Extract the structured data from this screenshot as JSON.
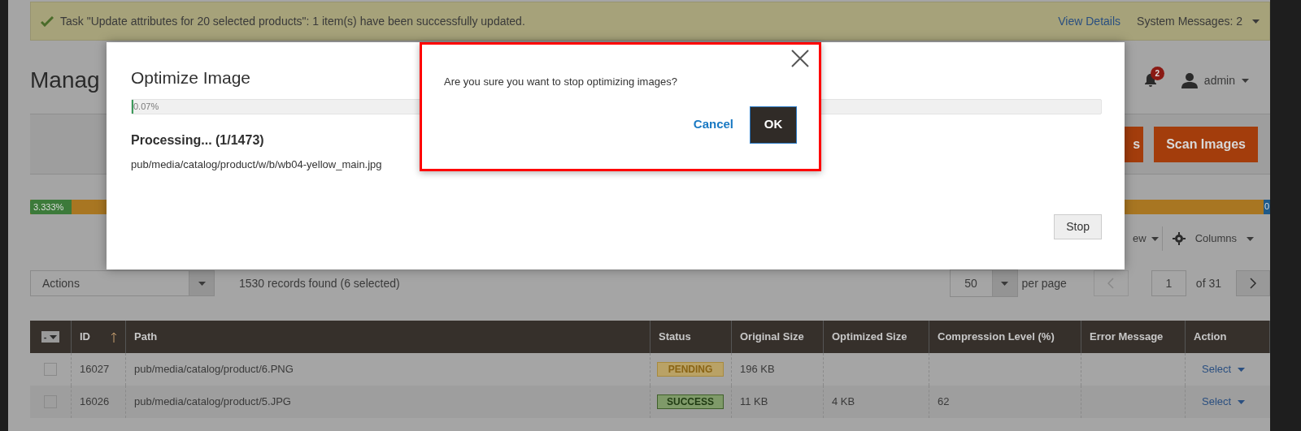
{
  "notification": {
    "message": "Task \"Update attributes for 20 selected products\": 1 item(s) have been successfully updated.",
    "link": "View Details",
    "system_messages": "System Messages: 2"
  },
  "header": {
    "title": "Manag",
    "notification_count": "2",
    "user": "admin"
  },
  "header_buttons": [
    {
      "label": "s"
    },
    {
      "label": "Scan Images"
    }
  ],
  "scan_progress": {
    "label": "3.333%",
    "level": 0.03333,
    "end_label": "0"
  },
  "toolbar": {
    "view": "ew",
    "columns": "Columns"
  },
  "grid": {
    "actions": "Actions",
    "records": "1530 records found (6 selected)",
    "per_page": "50",
    "per_page_label": "per page",
    "page": "1",
    "page_of": "of 31"
  },
  "table": {
    "mass_select": "-",
    "columns": [
      {
        "label": "ID",
        "sorted": true
      },
      {
        "label": "Path",
        "sorted": false
      },
      {
        "label": "Status",
        "sorted": false
      },
      {
        "label": "Original Size",
        "sorted": false
      },
      {
        "label": "Optimized Size",
        "sorted": false
      },
      {
        "label": "Compression Level (%)",
        "sorted": false
      },
      {
        "label": "Error Message",
        "sorted": false
      },
      {
        "label": "Action",
        "sorted": false
      }
    ],
    "rows": [
      {
        "checked": false,
        "id": "16027",
        "path": "pub/media/catalog/product/6.PNG",
        "status": {
          "label": "PENDING",
          "kind": "pending"
        },
        "original": "196 KB",
        "optimized": "",
        "compression": "",
        "error": "",
        "action": "Select"
      },
      {
        "checked": false,
        "id": "16026",
        "path": "pub/media/catalog/product/5.JPG",
        "status": {
          "label": "SUCCESS",
          "kind": "success"
        },
        "original": "11 KB",
        "optimized": "4 KB",
        "compression": "62",
        "error": "",
        "action": "Select"
      }
    ]
  },
  "optimize_modal": {
    "title": "Optimize Image",
    "progress_label": "0.07%",
    "level": 0.0007,
    "processing": "Processing... (1/1473)",
    "path": "pub/media/catalog/product/w/b/wb04-yellow_main.jpg",
    "stop": "Stop"
  },
  "confirm": {
    "message": "Are you sure you want to stop optimizing images?",
    "cancel": "Cancel",
    "ok": "OK"
  }
}
